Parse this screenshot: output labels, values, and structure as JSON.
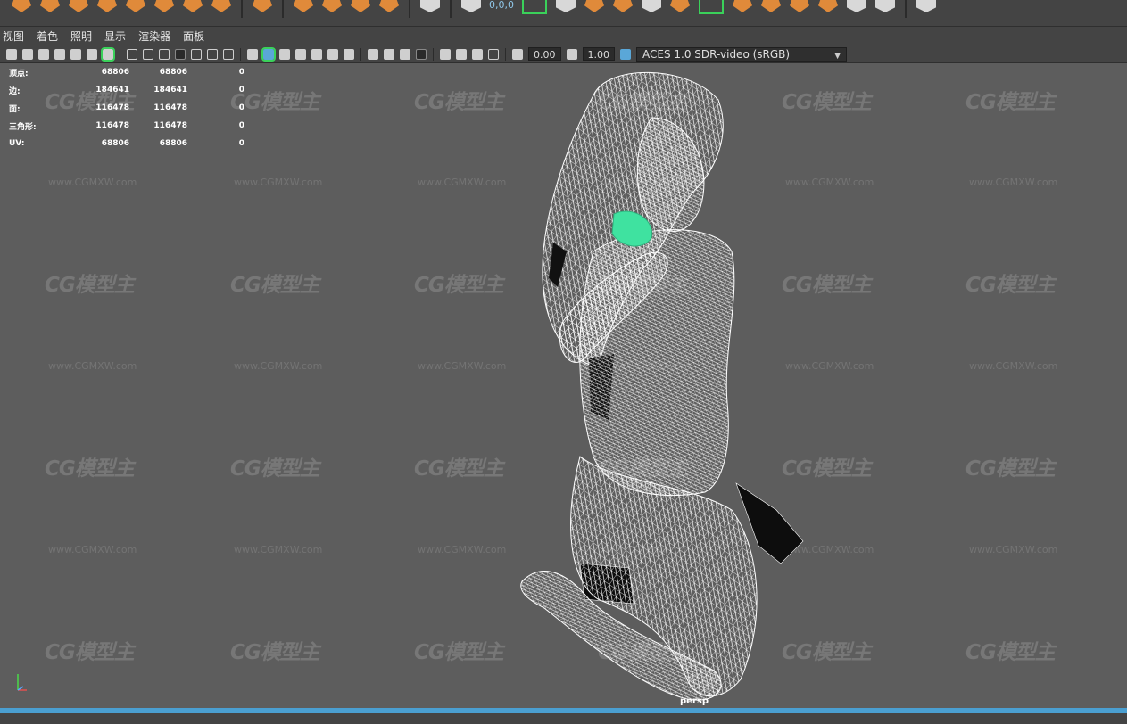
{
  "shelf": {
    "coord_text": "0,0,0"
  },
  "menu": [
    "视图",
    "着色",
    "照明",
    "显示",
    "渲染器",
    "面板"
  ],
  "toolbar": {
    "exposure": "0.00",
    "gamma": "1.00",
    "color_transform": "ACES 1.0 SDR-video (sRGB)"
  },
  "hud": [
    {
      "label": "顶点:",
      "v1": "68806",
      "v2": "68806",
      "v3": "0"
    },
    {
      "label": "边:",
      "v1": "184641",
      "v2": "184641",
      "v3": "0"
    },
    {
      "label": "面:",
      "v1": "116478",
      "v2": "116478",
      "v3": "0"
    },
    {
      "label": "三角形:",
      "v1": "116478",
      "v2": "116478",
      "v3": "0"
    },
    {
      "label": "UV:",
      "v1": "68806",
      "v2": "68806",
      "v3": "0"
    }
  ],
  "watermark": {
    "logo": "CG模型主",
    "url": "www.CGMXW.com"
  },
  "camera": "persp",
  "colors": {
    "viewport_bg": "#5d5d5d",
    "ui_bg": "#444444",
    "highlight_green": "#3ad15a",
    "selection_teal": "#3fe2a0",
    "timeline_blue": "#4a9fd1"
  }
}
